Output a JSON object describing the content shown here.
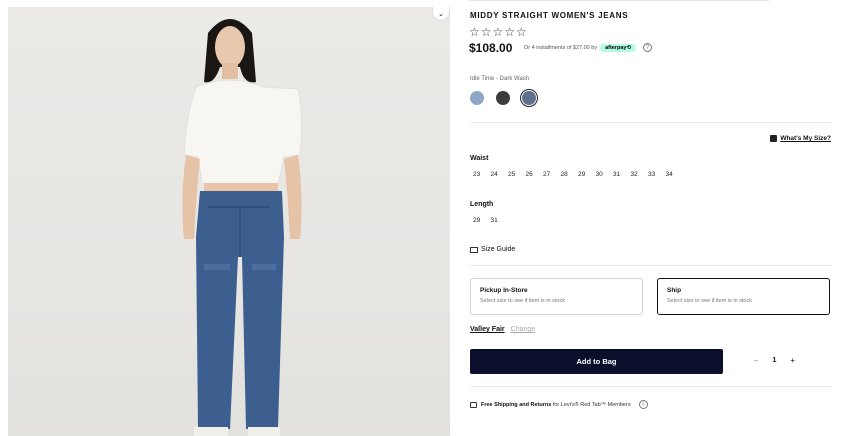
{
  "product": {
    "title": "MIDDY STRAIGHT WOMEN'S JEANS",
    "stars": "☆☆☆☆☆",
    "price": "$108.00",
    "installments": "Or 4 installments of $27.00 by",
    "afterpay_label": "afterpay⟲",
    "help_glyph": "?"
  },
  "color": {
    "name": "Idle Time - Dark Wash",
    "swatches": [
      {
        "color": "#8ea6c7",
        "selected": false
      },
      {
        "color": "#3c3c3c",
        "selected": false
      },
      {
        "color": "#5f6f8e",
        "selected": true
      }
    ]
  },
  "whats_my_size": "What's My Size?",
  "waist": {
    "label": "Waist",
    "sizes": [
      "23",
      "24",
      "25",
      "26",
      "27",
      "28",
      "29",
      "30",
      "31",
      "32",
      "33",
      "34"
    ]
  },
  "length": {
    "label": "Length",
    "sizes": [
      "29",
      "31"
    ]
  },
  "size_guide": "Size Guide",
  "fulfillment": {
    "pickup_title": "Pickup In-Store",
    "pickup_sub": "Select size to see if item is in stock",
    "ship_title": "Ship",
    "ship_sub": "Select size to see if item is in stock"
  },
  "store": {
    "name": "Valley Fair",
    "change": "Change"
  },
  "add_to_bag": "Add to Bag",
  "quantity": {
    "minus": "–",
    "value": "1",
    "plus": "+"
  },
  "shipping_note": {
    "bold": "Free Shipping and Returns",
    "rest": " for Levi's® Red Tab™ Members",
    "info_glyph": "i"
  }
}
